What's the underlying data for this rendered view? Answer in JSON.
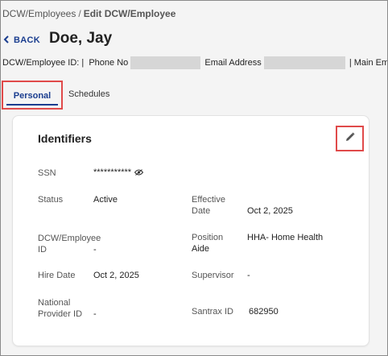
{
  "breadcrumb": {
    "parent": "DCW/Employees",
    "separator": "/",
    "current": "Edit DCW/Employee"
  },
  "header": {
    "back_label": "BACK",
    "title": "Doe, Jay"
  },
  "infobar": {
    "id_label": "DCW/Employee ID: |",
    "phone_label": "Phone No",
    "email_label": "Email Address",
    "emergency_label": "| Main Emerg"
  },
  "tabs": [
    {
      "label": "Personal",
      "active": true
    },
    {
      "label": "Schedules",
      "active": false
    }
  ],
  "identifiers": {
    "title": "Identifiers",
    "ssn": {
      "label": "SSN",
      "value": "***********"
    },
    "status": {
      "label": "Status",
      "value": "Active"
    },
    "effective_date": {
      "label_line1": "Effective",
      "label_line2": "Date",
      "value": "Oct 2, 2025"
    },
    "employee_id": {
      "label_line1": "DCW/Employee",
      "label_line2": "ID",
      "value": "-"
    },
    "position": {
      "label": "Position",
      "value_line1": "HHA- Home Health",
      "value_line2": "Aide"
    },
    "hire_date": {
      "label": "Hire Date",
      "value": "Oct 2, 2025"
    },
    "supervisor": {
      "label": "Supervisor",
      "value": "-"
    },
    "npi": {
      "label_line1": "National",
      "label_line2": "Provider ID",
      "value": "-"
    },
    "santrax": {
      "label": "Santrax ID",
      "value": "682950"
    }
  },
  "colors": {
    "accent": "#1a3d8f",
    "highlight": "#e04a4a",
    "redaction": "#d6d6d6"
  },
  "icons": {
    "back": "chevron-left-icon",
    "edit": "pencil-icon",
    "ssn_toggle": "eye-icon"
  }
}
